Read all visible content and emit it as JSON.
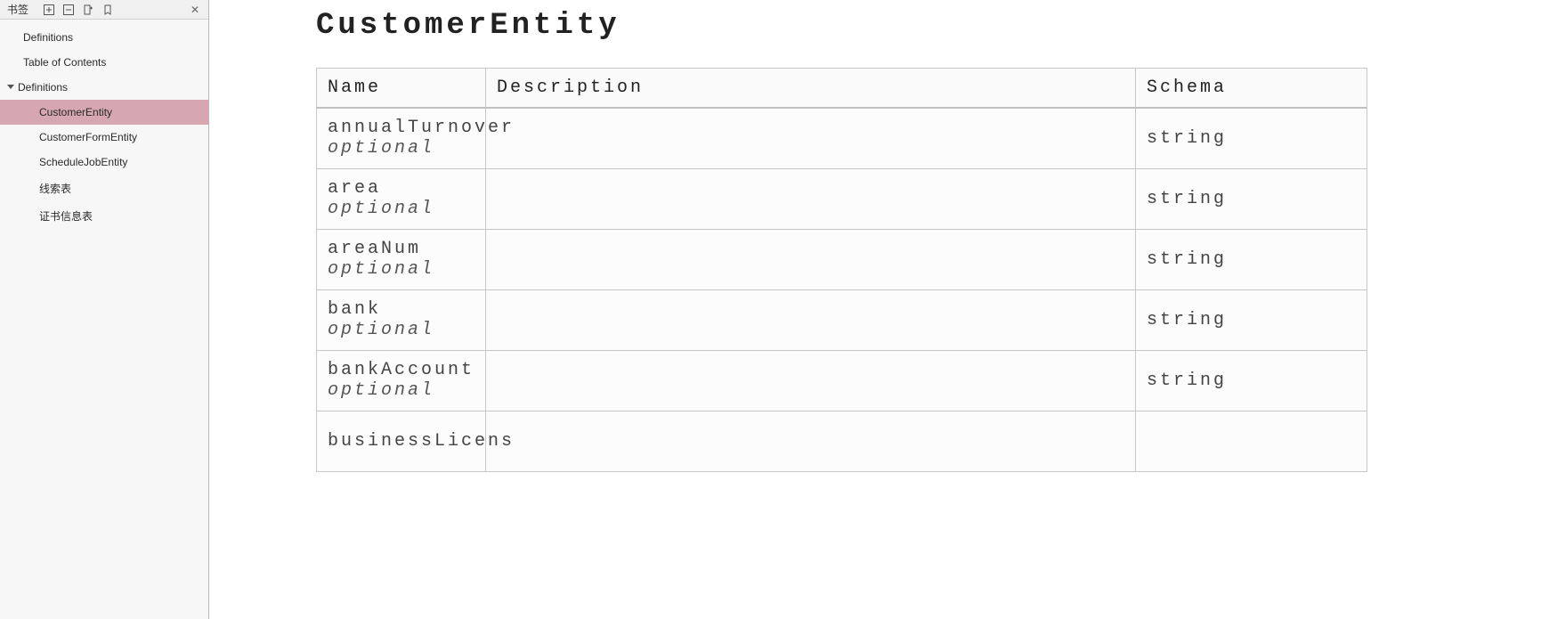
{
  "sidebar": {
    "title": "书签",
    "icons": [
      "expand-all-icon",
      "collapse-all-icon",
      "new-bookmark-icon",
      "bookmark-icon"
    ],
    "close": "✕",
    "items": [
      {
        "label": "Definitions",
        "level": 0,
        "selected": false,
        "expandable": false
      },
      {
        "label": "Table of Contents",
        "level": 0,
        "selected": false,
        "expandable": false
      },
      {
        "label": "Definitions",
        "level": 0,
        "selected": false,
        "expandable": true
      },
      {
        "label": "CustomerEntity",
        "level": 1,
        "selected": true,
        "expandable": false
      },
      {
        "label": "CustomerFormEntity",
        "level": 1,
        "selected": false,
        "expandable": false
      },
      {
        "label": "ScheduleJobEntity",
        "level": 1,
        "selected": false,
        "expandable": false
      },
      {
        "label": "线索表",
        "level": 1,
        "selected": false,
        "expandable": false
      },
      {
        "label": "证书信息表",
        "level": 1,
        "selected": false,
        "expandable": false
      }
    ]
  },
  "main": {
    "title": "CustomerEntity",
    "columns": [
      "Name",
      "Description",
      "Schema"
    ],
    "rows": [
      {
        "name": "annualTurnover",
        "modifier": "optional",
        "description": "",
        "schema": "string"
      },
      {
        "name": "area",
        "modifier": "optional",
        "description": "",
        "schema": "string"
      },
      {
        "name": "areaNum",
        "modifier": "optional",
        "description": "",
        "schema": "string"
      },
      {
        "name": "bank",
        "modifier": "optional",
        "description": "",
        "schema": "string"
      },
      {
        "name": "bankAccount",
        "modifier": "optional",
        "description": "",
        "schema": "string"
      },
      {
        "name": "businessLicens",
        "modifier": "",
        "description": "",
        "schema": ""
      }
    ]
  }
}
